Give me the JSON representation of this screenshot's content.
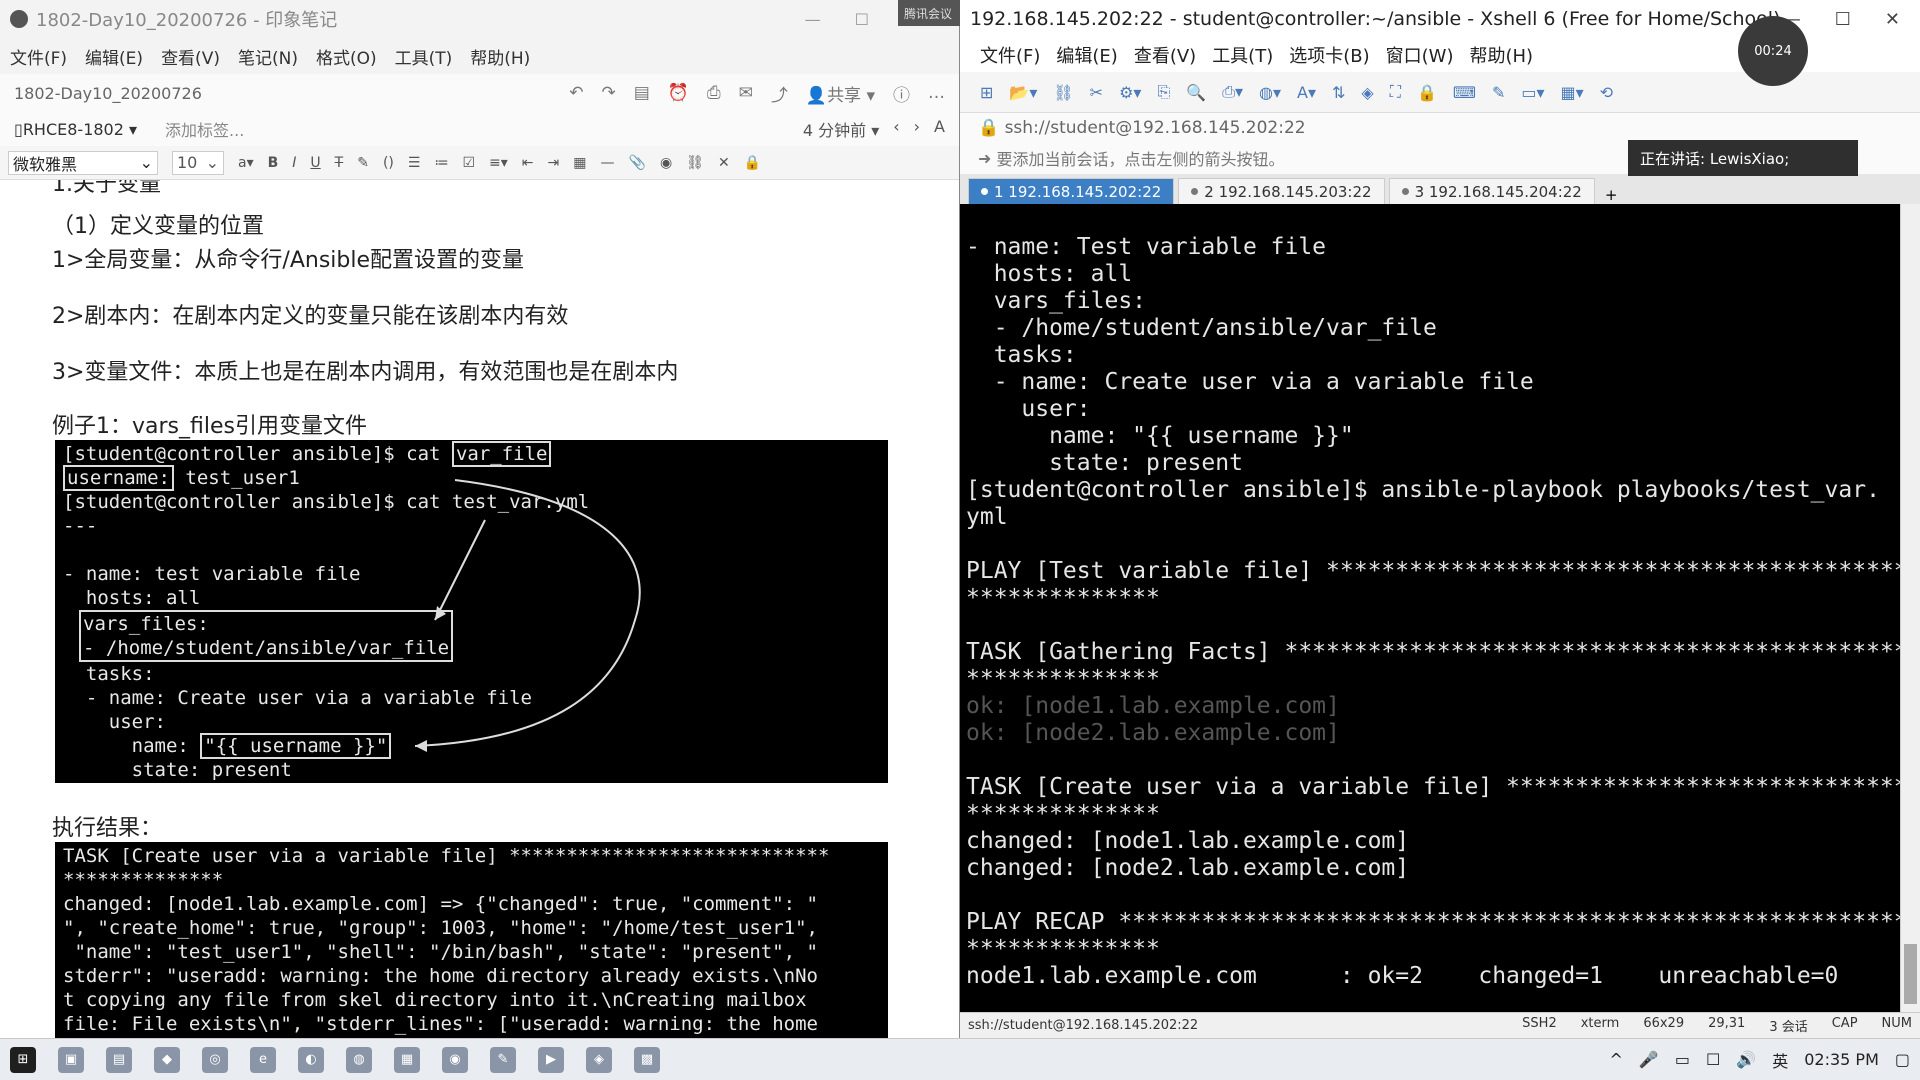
{
  "evernote": {
    "window_title": "1802-Day10_20200726 - 印象笔记",
    "menu": [
      "文件(F)",
      "编辑(E)",
      "查看(V)",
      "笔记(N)",
      "格式(O)",
      "工具(T)",
      "帮助(H)"
    ],
    "note_title": "1802-Day10_20200726",
    "share_label": "共享",
    "notebook": "RHCE8-1802",
    "add_tag": "添加标签...",
    "edited": "4 分钟前",
    "font": "微软雅黑",
    "font_size": "10",
    "content": {
      "heading_partial": "1.关于变量",
      "h_def": "（1）定义变量的位置",
      "p1": "1>全局变量：从命令行/Ansible配置设置的变量",
      "p2": "2>剧本内：在剧本内定义的变量只能在该剧本内有效",
      "p3": "3>变量文件：本质上也是在剧本内调用，有效范围也是在剧本内",
      "example": "例子1：vars_files引用变量文件",
      "result_label": "执行结果："
    },
    "img1_lines": [
      "[student@controller ansible]$ cat ",
      "var_file",
      "username:",
      " test_user1",
      "[student@controller ansible]$ cat test_var.yml",
      "---",
      "",
      "- name: test variable file",
      "  hosts: all",
      "vars_files:",
      "- /home/student/ansible/var_file",
      "  tasks:",
      "  - name: Create user via a variable file",
      "    user:",
      "      name: ",
      "\"{{ username }}\"",
      "      state: present"
    ],
    "img2_lines": [
      "TASK [Create user via a variable file] ****************************",
      "**************",
      "changed: [node1.lab.example.com] => {\"changed\": true, \"comment\": \"",
      "\", \"create_home\": true, \"group\": 1003, \"home\": \"/home/test_user1\",",
      " \"name\": \"test_user1\", \"shell\": \"/bin/bash\", \"state\": \"present\", \"",
      "stderr\": \"useradd: warning: the home directory already exists.\\nNo",
      "t copying any file from skel directory into it.\\nCreating mailbox",
      "file: File exists\\n\", \"stderr_lines\": [\"useradd: warning: the home"
    ]
  },
  "xshell": {
    "window_title": "192.168.145.202:22 - student@controller:~/ansible - Xshell 6 (Free for Home/School)",
    "menu": [
      "文件(F)",
      "编辑(E)",
      "查看(V)",
      "工具(T)",
      "选项卡(B)",
      "窗口(W)",
      "帮助(H)"
    ],
    "address": "ssh://student@192.168.145.202:22",
    "hint": "要添加当前会话，点击左侧的箭头按钮。",
    "tabs": [
      "1 192.168.145.202:22",
      "2 192.168.145.203:22",
      "3 192.168.145.204:22"
    ],
    "terminal_lines": [
      "- name: Test variable file",
      "  hosts: all",
      "  vars_files:",
      "  - /home/student/ansible/var_file",
      "  tasks:",
      "  - name: Create user via a variable file",
      "    user:",
      "      name: \"{{ username }}\"",
      "      state: present",
      "[student@controller ansible]$ ansible-playbook playbooks/test_var.",
      "yml",
      "",
      "PLAY [Test variable file] ******************************************",
      "**************",
      "",
      "TASK [Gathering Facts] *********************************************",
      "**************",
      "ok: [node1.lab.example.com]",
      "ok: [node2.lab.example.com]",
      "",
      "TASK [Create user via a variable file] *****************************",
      "**************",
      "changed: [node1.lab.example.com]",
      "changed: [node2.lab.example.com]",
      "",
      "PLAY RECAP *********************************************************",
      "**************",
      "node1.lab.example.com      : ok=2    changed=1    unreachable=0"
    ],
    "status": {
      "address": "ssh://student@192.168.145.202:22",
      "protocol": "SSH2",
      "term": "xterm",
      "size": "66x29",
      "cursor": "29,31",
      "sessions": "3 会话",
      "cap": "CAP",
      "num": "NUM"
    }
  },
  "meeting": {
    "speaking": "正在讲话: LewisXiao;",
    "badge": "腾讯会议",
    "timer": "00:24"
  },
  "taskbar": {
    "clock": "02:35 PM"
  }
}
